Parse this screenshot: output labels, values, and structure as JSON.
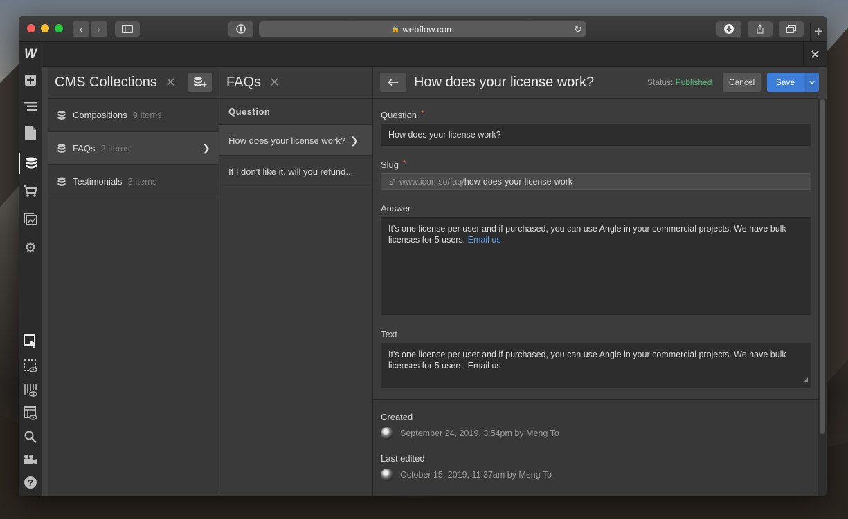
{
  "browser": {
    "url": "webflow.com"
  },
  "app": {
    "logo": "W"
  },
  "collections_pane": {
    "title": "CMS Collections",
    "items": [
      {
        "name": "Compositions",
        "count": "9 items"
      },
      {
        "name": "FAQs",
        "count": "2 items"
      },
      {
        "name": "Testimonials",
        "count": "3 items"
      }
    ]
  },
  "items_pane": {
    "title": "FAQs",
    "column_header": "Question",
    "items": [
      {
        "label": "How does your license work?"
      },
      {
        "label": "If I don't like it, will you refund..."
      }
    ]
  },
  "editor": {
    "title": "How does your license work?",
    "status_label": "Status:",
    "status_value": "Published",
    "cancel_label": "Cancel",
    "save_label": "Save",
    "fields": {
      "question_label": "Question",
      "question_value": "How does your license work?",
      "slug_label": "Slug",
      "slug_prefix": "www.icon.so/faq/",
      "slug_value": "how-does-your-license-work",
      "answer_label": "Answer",
      "answer_text": "It's one license per user and if purchased, you can use Angle in your commercial projects. We have bulk licenses for 5 users.",
      "answer_link": "Email us",
      "text_label": "Text",
      "text_value": "It's one license per user and if purchased, you can use Angle in your commercial projects. We have bulk licenses for 5 users. Email us"
    },
    "meta": {
      "created_label": "Created",
      "created_value": "September 24, 2019, 3:54pm by Meng To",
      "edited_label": "Last edited",
      "edited_value": "October 15, 2019, 11:37am by Meng To"
    }
  },
  "colors": {
    "accent": "#3d7edb",
    "published": "#4fc279",
    "link": "#5aa0f0",
    "required": "#e05a5a"
  }
}
